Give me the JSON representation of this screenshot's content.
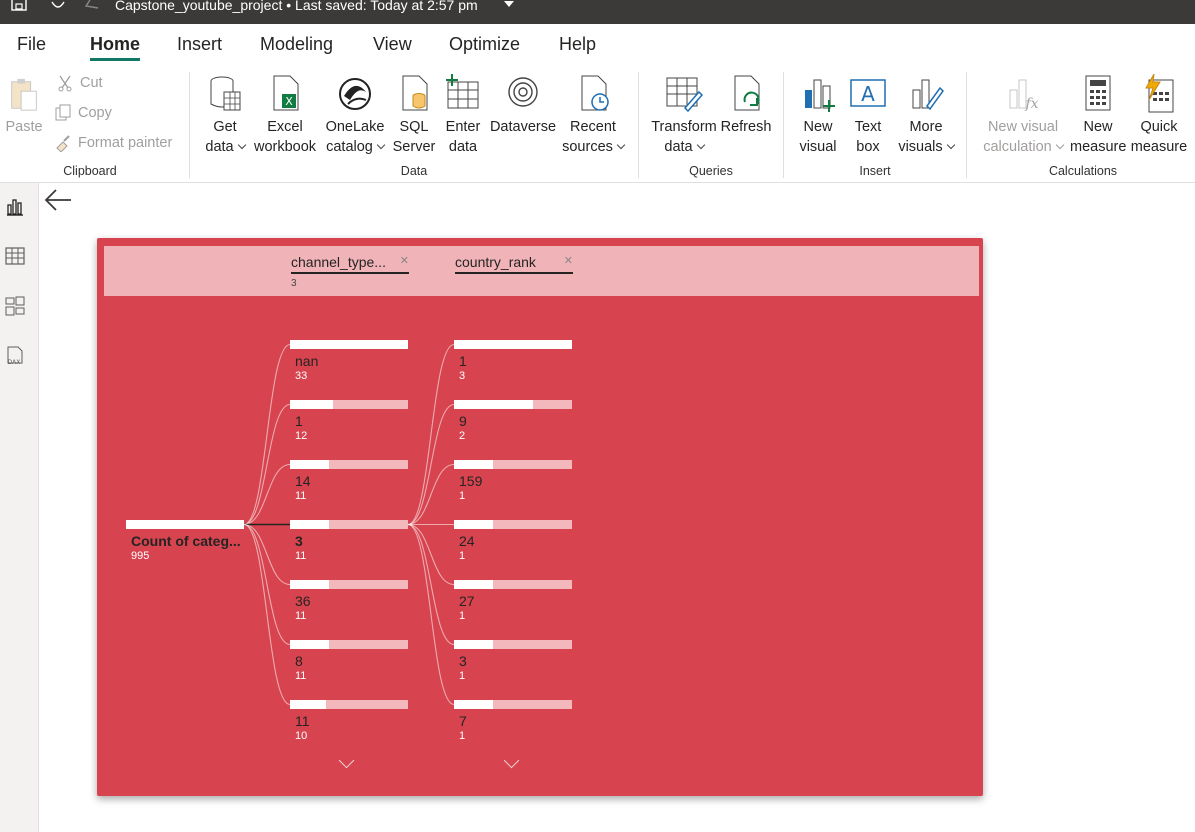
{
  "titlebar": {
    "title": "Capstone_youtube_project",
    "separator": "•",
    "saved": "Last saved: Today at 2:57 pm"
  },
  "menu": [
    "File",
    "Home",
    "Insert",
    "Modeling",
    "View",
    "Optimize",
    "Help"
  ],
  "menu_active": "Home",
  "ribbon": {
    "clipboard": {
      "paste": "Paste",
      "cut": "Cut",
      "copy": "Copy",
      "format_painter": "Format painter",
      "group": "Clipboard"
    },
    "data": {
      "group": "Data",
      "buttons": [
        {
          "line1": "Get",
          "line2": "data",
          "icon": "database-icon"
        },
        {
          "line1": "Excel",
          "line2": "workbook",
          "icon": "excel-icon"
        },
        {
          "line1": "OneLake",
          "line2": "catalog",
          "icon": "onelake-icon"
        },
        {
          "line1": "SQL",
          "line2": "Server",
          "icon": "sql-server-icon"
        },
        {
          "line1": "Enter",
          "line2": "data",
          "icon": "table-plus-icon"
        },
        {
          "line1": "Dataverse",
          "line2": "",
          "icon": "dataverse-icon"
        },
        {
          "line1": "Recent",
          "line2": "sources",
          "icon": "recent-icon"
        }
      ]
    },
    "queries": {
      "group": "Queries",
      "transform_1": "Transform",
      "transform_2": "data",
      "refresh": "Refresh"
    },
    "insert": {
      "group": "Insert",
      "new_visual_1": "New",
      "new_visual_2": "visual",
      "text_box_1": "Text",
      "text_box_2": "box",
      "more_visuals_1": "More",
      "more_visuals_2": "visuals"
    },
    "calculations": {
      "group": "Calculations",
      "new_visual_calc_1": "New visual",
      "new_visual_calc_2": "calculation",
      "new_measure_1": "New",
      "new_measure_2": "measure",
      "quick_measure_1": "Quick",
      "quick_measure_2": "measure"
    }
  },
  "colors": {
    "visual_bg": "#d7444f",
    "header_bg": "#f0b4b8",
    "accent": "#117865"
  },
  "tree": {
    "levels": [
      {
        "title": "channel_type...",
        "subtitle": "3"
      },
      {
        "title": "country_rank",
        "subtitle": ""
      }
    ],
    "root": {
      "label": "Count of categ...",
      "count": "995",
      "value": 995
    },
    "level1": [
      {
        "label": "nan",
        "count": "33",
        "value": 33
      },
      {
        "label": "1",
        "count": "12",
        "value": 12
      },
      {
        "label": "14",
        "count": "11",
        "value": 11
      },
      {
        "label": "3",
        "count": "11",
        "value": 11,
        "selected": true
      },
      {
        "label": "36",
        "count": "11",
        "value": 11
      },
      {
        "label": "8",
        "count": "11",
        "value": 11
      },
      {
        "label": "11",
        "count": "10",
        "value": 10
      }
    ],
    "level2": [
      {
        "label": "1",
        "count": "3",
        "value": 3
      },
      {
        "label": "9",
        "count": "2",
        "value": 2
      },
      {
        "label": "159",
        "count": "1",
        "value": 1
      },
      {
        "label": "24",
        "count": "1",
        "value": 1
      },
      {
        "label": "27",
        "count": "1",
        "value": 1
      },
      {
        "label": "3",
        "count": "1",
        "value": 1
      },
      {
        "label": "7",
        "count": "1",
        "value": 1
      }
    ]
  }
}
